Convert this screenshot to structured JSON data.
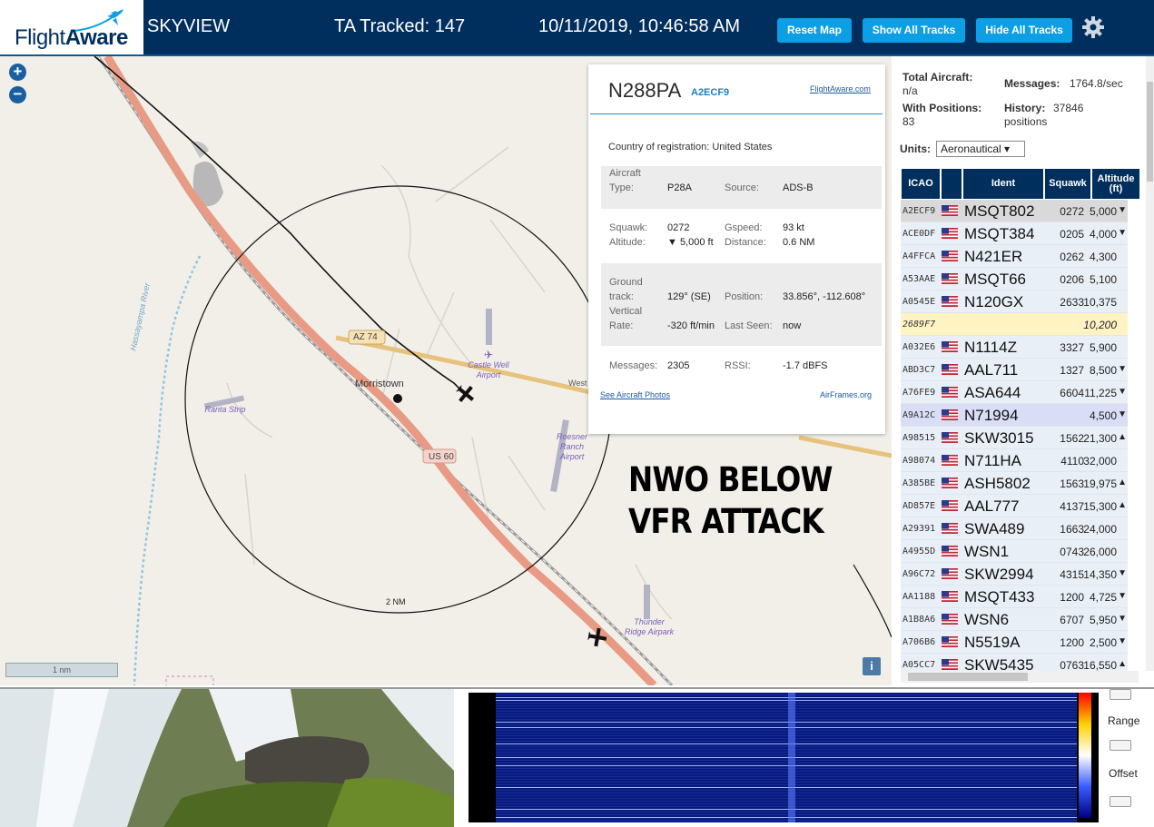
{
  "header": {
    "logo_text_light": "Flight",
    "logo_text_bold": "Aware",
    "title": "SKYVIEW",
    "tracked": "TA Tracked: 147",
    "datetime": "10/11/2019, 10:46:58 AM",
    "reset_map": "Reset Map",
    "show_all": "Show All Tracks",
    "hide_all": "Hide All Tracks",
    "settings_icon": "gear-icon",
    "brand_color": "#002f5d",
    "button_color": "#0d9fe6"
  },
  "map": {
    "zoom_in": "+",
    "zoom_out": "−",
    "labels": {
      "morristown": "Morristown",
      "az74": "AZ 74",
      "us60": "US 60",
      "west": "West",
      "range_ring": "2 NM",
      "castle_well_1": "Castle Well",
      "castle_well_2": "Airport",
      "ranta": "Ranta Strip",
      "roesner_1": "Roesner",
      "roesner_2": "Ranch",
      "roesner_3": "Airport",
      "thunder_1": "Thunder",
      "thunder_2": "Ridge Airpark",
      "river": "Hassayampa River"
    },
    "scale": "1 nm",
    "info": "i",
    "overlay_line1": "NWO BELOW",
    "overlay_line2": "VFR ATTACK"
  },
  "popup": {
    "registration": "N288PA",
    "hex": "A2ECF9",
    "fa_link": "FlightAware.com",
    "country_label": "Country of registration:",
    "country_value": "United States",
    "aircraft_type_label_1": "Aircraft",
    "aircraft_type_label_2": "Type:",
    "aircraft_type": "P28A",
    "source_label": "Source:",
    "source": "ADS-B",
    "squawk_label": "Squawk:",
    "squawk": "0272",
    "gspeed_label": "Gspeed:",
    "gspeed": "93 kt",
    "altitude_label": "Altitude:",
    "altitude": "▼ 5,000 ft",
    "distance_label": "Distance:",
    "distance": "0.6 NM",
    "ground_label_1": "Ground",
    "ground_label_2": "track:",
    "ground_track": "129° (SE)",
    "position_label": "Position:",
    "position": "33.856°, -112.608°",
    "vertical_label_1": "Vertical",
    "vertical_label_2": "Rate:",
    "vertical_rate": "-320 ft/min",
    "last_seen_label": "Last Seen:",
    "last_seen": "now",
    "messages_label": "Messages:",
    "messages": "2305",
    "rssi_label": "RSSI:",
    "rssi": "-1.7 dBFS",
    "photos_link": "See Aircraft Photos",
    "airframes_link": "AirFrames.org"
  },
  "sidebar": {
    "total_label": "Total Aircraft:",
    "total_value": "n/a",
    "messages_label": "Messages:",
    "messages_value": "1764.8/sec",
    "positions_label": "With Positions:",
    "positions_value": "83",
    "history_label": "History:",
    "history_value": "37846",
    "history_unit": "positions",
    "units_label": "Units:",
    "units_value": "Aeronautical ▾",
    "columns": [
      "ICAO",
      "Ident",
      "Squawk",
      "Altitude (ft)"
    ],
    "rows": [
      {
        "icao": "A2ECF9",
        "ident": "MSQT802",
        "squawk": "0272",
        "alt": "5,000",
        "arrow": "▼",
        "flag": true,
        "style": "selected"
      },
      {
        "icao": "ACE0DF",
        "ident": "MSQT384",
        "squawk": "0205",
        "alt": "4,000",
        "arrow": "▼",
        "flag": true,
        "style": ""
      },
      {
        "icao": "A4FFCA",
        "ident": "N421ER",
        "squawk": "0262",
        "alt": "4,300",
        "arrow": "",
        "flag": true,
        "style": ""
      },
      {
        "icao": "A53AAE",
        "ident": "MSQT66",
        "squawk": "0206",
        "alt": "5,100",
        "arrow": "",
        "flag": true,
        "style": ""
      },
      {
        "icao": "A0545E",
        "ident": "N120GX",
        "squawk": "2633",
        "alt": "10,375",
        "arrow": "",
        "flag": true,
        "style": ""
      },
      {
        "icao": "2689F7",
        "ident": "",
        "squawk": "",
        "alt": "10,200",
        "arrow": "",
        "flag": false,
        "style": "mlat"
      },
      {
        "icao": "A032E6",
        "ident": "N1114Z",
        "squawk": "3327",
        "alt": "5,900",
        "arrow": "",
        "flag": true,
        "style": ""
      },
      {
        "icao": "ABD3C7",
        "ident": "AAL711",
        "squawk": "1327",
        "alt": "8,500",
        "arrow": "▼",
        "flag": true,
        "style": ""
      },
      {
        "icao": "A76FE9",
        "ident": "ASA644",
        "squawk": "6604",
        "alt": "11,225",
        "arrow": "▼",
        "flag": true,
        "style": ""
      },
      {
        "icao": "A9A12C",
        "ident": "N71994",
        "squawk": "",
        "alt": "4,500",
        "arrow": "▼",
        "flag": true,
        "style": "tisb"
      },
      {
        "icao": "A98515",
        "ident": "SKW3015",
        "squawk": "1562",
        "alt": "21,300",
        "arrow": "▲",
        "flag": true,
        "style": ""
      },
      {
        "icao": "A98074",
        "ident": "N711HA",
        "squawk": "4110",
        "alt": "32,000",
        "arrow": "",
        "flag": true,
        "style": ""
      },
      {
        "icao": "A385BE",
        "ident": "ASH5802",
        "squawk": "1563",
        "alt": "19,975",
        "arrow": "▲",
        "flag": true,
        "style": ""
      },
      {
        "icao": "AD857E",
        "ident": "AAL777",
        "squawk": "4137",
        "alt": "15,300",
        "arrow": "▲",
        "flag": true,
        "style": ""
      },
      {
        "icao": "A29391",
        "ident": "SWA489",
        "squawk": "1663",
        "alt": "24,000",
        "arrow": "",
        "flag": true,
        "style": ""
      },
      {
        "icao": "A4955D",
        "ident": "WSN1",
        "squawk": "0743",
        "alt": "26,000",
        "arrow": "",
        "flag": true,
        "style": ""
      },
      {
        "icao": "A96C72",
        "ident": "SKW2994",
        "squawk": "4315",
        "alt": "14,350",
        "arrow": "▼",
        "flag": true,
        "style": ""
      },
      {
        "icao": "AA1188",
        "ident": "MSQT433",
        "squawk": "1200",
        "alt": "4,725",
        "arrow": "▼",
        "flag": true,
        "style": ""
      },
      {
        "icao": "A1B8A6",
        "ident": "WSN6",
        "squawk": "6707",
        "alt": "5,950",
        "arrow": "▼",
        "flag": true,
        "style": ""
      },
      {
        "icao": "A706B6",
        "ident": "N5519A",
        "squawk": "1200",
        "alt": "2,500",
        "arrow": "▼",
        "flag": true,
        "style": ""
      },
      {
        "icao": "A05CC7",
        "ident": "SKW5435",
        "squawk": "0763",
        "alt": "16,550",
        "arrow": "▲",
        "flag": true,
        "style": ""
      }
    ]
  },
  "bottom": {
    "range_label": "Range",
    "offset_label": "Offset"
  }
}
